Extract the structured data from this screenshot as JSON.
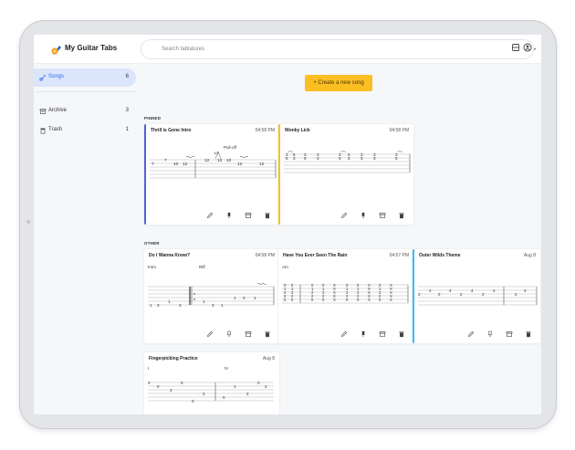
{
  "app": {
    "title": "My Guitar Tabs"
  },
  "search": {
    "placeholder": "Search tablatures"
  },
  "sidebar": {
    "items": [
      {
        "label": "Songs",
        "count": "6",
        "icon": "guitar-icon",
        "active": true
      },
      {
        "label": "Archive",
        "count": "3",
        "icon": "archive-icon",
        "active": false
      },
      {
        "label": "Trash",
        "count": "1",
        "icon": "trash-icon",
        "active": false
      }
    ]
  },
  "main": {
    "create_label": "+ Create a new song",
    "pinned_label": "PINNED",
    "others_label": "OTHER",
    "pinned": [
      {
        "title": "Thrill is Gone Intro",
        "time": "04:58 PM",
        "accent": "#4f63d8",
        "annotation_top": "Pull-off",
        "annotation_frac": "1/2"
      },
      {
        "title": "Wonky Lick",
        "time": "04:58 PM",
        "accent": "#fbbf24"
      }
    ],
    "others": [
      {
        "title": "Do I Wanna Know?",
        "time": "04:58 PM",
        "accent": "",
        "left_label": "Intro",
        "right_label": "Riff"
      },
      {
        "title": "Have You Ever Seen The Rain",
        "time": "04:57 PM",
        "accent": "",
        "left_label": "Am"
      },
      {
        "title": "Outer Wilds Theme",
        "time": "Aug 8",
        "accent": "#38bdf8"
      },
      {
        "title": "Fingerpicking Practice",
        "time": "Aug 8",
        "accent": "",
        "left_label": "I",
        "right_label": "IV"
      }
    ]
  },
  "colors": {
    "accent_blue": "#4f63d8",
    "accent_yellow": "#fbbf24",
    "accent_cyan": "#38bdf8",
    "active_nav": "#dbe5fb"
  }
}
